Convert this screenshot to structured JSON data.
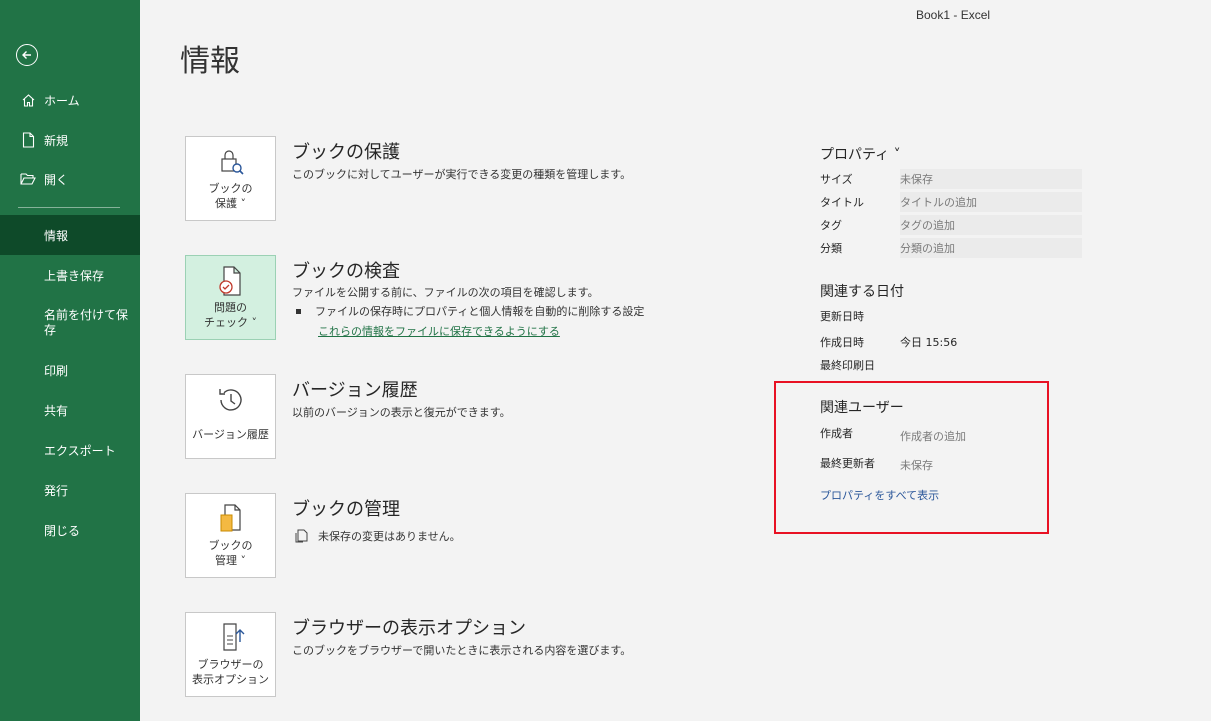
{
  "window": {
    "title": "Book1  -  Excel"
  },
  "page": {
    "title": "情報"
  },
  "sidebar": {
    "items": [
      {
        "label": "ホーム",
        "icon": "home-icon"
      },
      {
        "label": "新規",
        "icon": "new-document-icon"
      },
      {
        "label": "開く",
        "icon": "folder-open-icon"
      },
      {
        "label": "情報",
        "active": true
      },
      {
        "label": "上書き保存"
      },
      {
        "label": "名前を付けて保\n存"
      },
      {
        "label": "印刷"
      },
      {
        "label": "共有"
      },
      {
        "label": "エクスポート"
      },
      {
        "label": "発行"
      },
      {
        "label": "閉じる"
      }
    ]
  },
  "sections": {
    "protect": {
      "tile_label_1": "ブックの",
      "tile_label_2": "保護 ˅",
      "heading": "ブックの保護",
      "desc": "このブックに対してユーザーが実行できる変更の種類を管理します。"
    },
    "inspect": {
      "tile_label_1": "問題の",
      "tile_label_2": "チェック ˅",
      "heading": "ブックの検査",
      "desc": "ファイルを公開する前に、ファイルの次の項目を確認します。",
      "bullet": "ファイルの保存時にプロパティと個人情報を自動的に削除する設定",
      "link": "これらの情報をファイルに保存できるようにする"
    },
    "versions": {
      "tile_label_1": "バージョン履歴",
      "heading": "バージョン履歴",
      "desc": "以前のバージョンの表示と復元ができます。"
    },
    "manage": {
      "tile_label_1": "ブックの",
      "tile_label_2": "管理 ˅",
      "heading": "ブックの管理",
      "desc": "未保存の変更はありません。"
    },
    "browser": {
      "tile_label_1": "ブラウザーの",
      "tile_label_2": "表示オプション",
      "heading": "ブラウザーの表示オプション",
      "desc": "このブックをブラウザーで開いたときに表示される内容を選びます。"
    }
  },
  "properties": {
    "heading": "プロパティ ˅",
    "rows": [
      {
        "key": "サイズ",
        "value": "未保存"
      },
      {
        "key": "タイトル",
        "value": "タイトルの追加"
      },
      {
        "key": "タグ",
        "value": "タグの追加"
      },
      {
        "key": "分類",
        "value": "分類の追加"
      }
    ]
  },
  "dates": {
    "heading": "関連する日付",
    "rows": [
      {
        "key": "更新日時",
        "value": ""
      },
      {
        "key": "作成日時",
        "value": "今日 15:56"
      },
      {
        "key": "最終印刷日",
        "value": ""
      }
    ]
  },
  "users": {
    "heading": "関連ユーザー",
    "rows": [
      {
        "key": "作成者",
        "value": "作成者の追加"
      },
      {
        "key": "最終更新者",
        "value": "未保存"
      }
    ],
    "show_all_link": "プロパティをすべて表示"
  },
  "colors": {
    "accent": "#217346",
    "active_nav": "#0e4a29",
    "highlight": "#e81123",
    "link": "#2b579a"
  }
}
